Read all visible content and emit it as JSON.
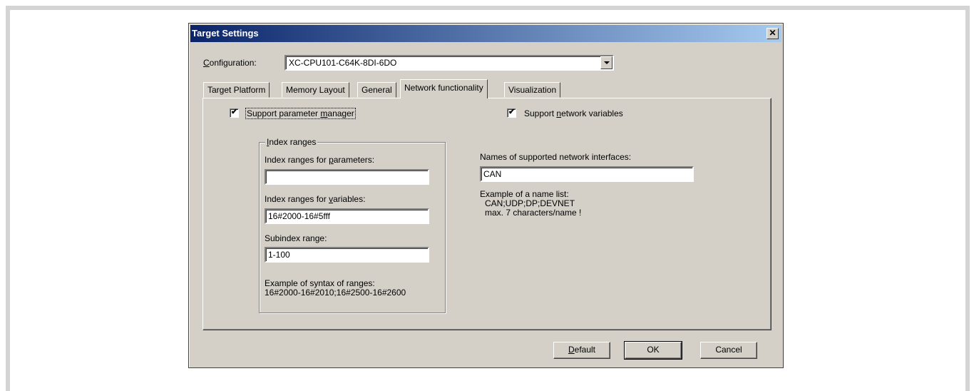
{
  "dialog": {
    "title": "Target Settings",
    "close_glyph": "✕"
  },
  "configuration": {
    "label_first": "C",
    "label_rest": "onfiguration:",
    "value": "XC-CPU101-C64K-8DI-6DO"
  },
  "tabs": [
    {
      "label": "Target Platform"
    },
    {
      "label": "Memory Layout"
    },
    {
      "label": "General"
    },
    {
      "label": "Network functionality"
    },
    {
      "label": "Visualization"
    }
  ],
  "active_tab": "Network functionality",
  "param_manager": {
    "checked": true,
    "label_pre": "Support parameter ",
    "label_ul": "m",
    "label_post": "anager"
  },
  "network_vars": {
    "checked": true,
    "label_pre": "Support ",
    "label_ul": "n",
    "label_post": "etwork variables"
  },
  "index_ranges": {
    "legend_ul": "I",
    "legend_rest": "ndex ranges",
    "params_label_pre": "Index ranges for ",
    "params_label_ul": "p",
    "params_label_post": "arameters:",
    "params_value": "",
    "vars_label_pre": "Index ranges for ",
    "vars_label_ul": "v",
    "vars_label_post": "ariables:",
    "vars_value": "16#2000-16#5fff",
    "subindex_label": "Subindex range:",
    "subindex_value": "1-100",
    "example_line1": "Example of syntax of ranges:",
    "example_line2": "16#2000-16#2010;16#2500-16#2600"
  },
  "interfaces": {
    "label": "Names of supported network interfaces:",
    "value": "CAN",
    "example_line1": "Example of a name list:",
    "example_line2": "CAN;UDP;DP;DEVNET",
    "example_line3": "max. 7 characters/name !"
  },
  "buttons": {
    "default_ul": "D",
    "default_rest": "efault",
    "ok": "OK",
    "cancel": "Cancel"
  }
}
